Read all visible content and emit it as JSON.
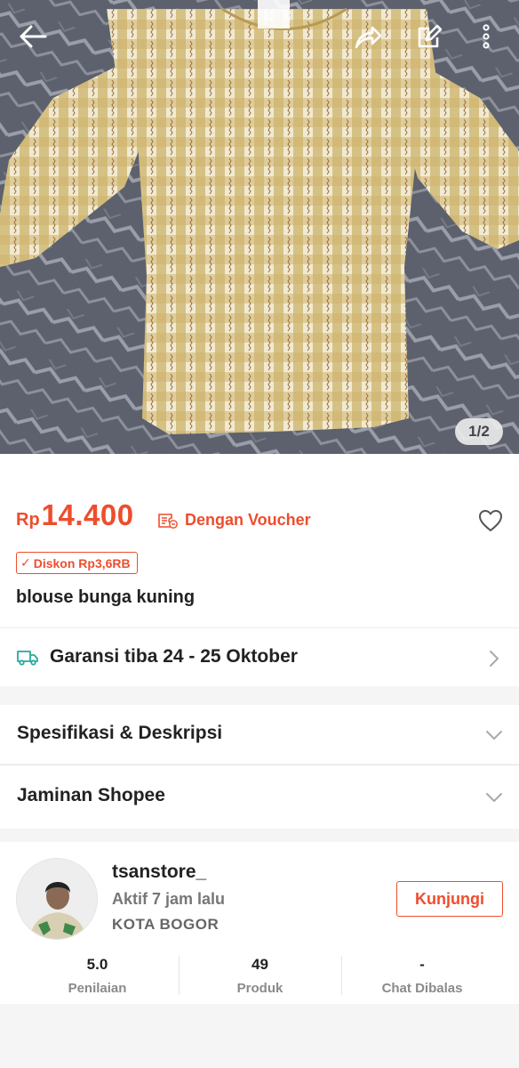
{
  "header": {
    "back_icon": "arrow-left-icon",
    "share_icon": "share-icon",
    "edit_icon": "edit-icon",
    "more_icon": "more-vertical-icon"
  },
  "gallery": {
    "indicator": "1/2"
  },
  "product": {
    "currency": "Rp",
    "price": "14.400",
    "voucher_label": "Dengan Voucher",
    "discount_label": "Diskon Rp3,6RB",
    "title": "blouse bunga kuning",
    "accent_color": "#ee4d2d"
  },
  "shipping": {
    "label": "Garansi tiba 24 - 25 Oktober",
    "icon": "truck-icon",
    "icon_color": "#26aa99"
  },
  "sections": [
    {
      "label": "Spesifikasi & Deskripsi"
    },
    {
      "label": "Jaminan Shopee"
    }
  ],
  "shop": {
    "name": "tsanstore_",
    "status": "Aktif 7 jam lalu",
    "location": "KOTA BOGOR",
    "visit_label": "Kunjungi",
    "stats": [
      {
        "value": "5.0",
        "label": "Penilaian"
      },
      {
        "value": "49",
        "label": "Produk"
      },
      {
        "value": "-",
        "label": "Chat Dibalas"
      }
    ]
  }
}
